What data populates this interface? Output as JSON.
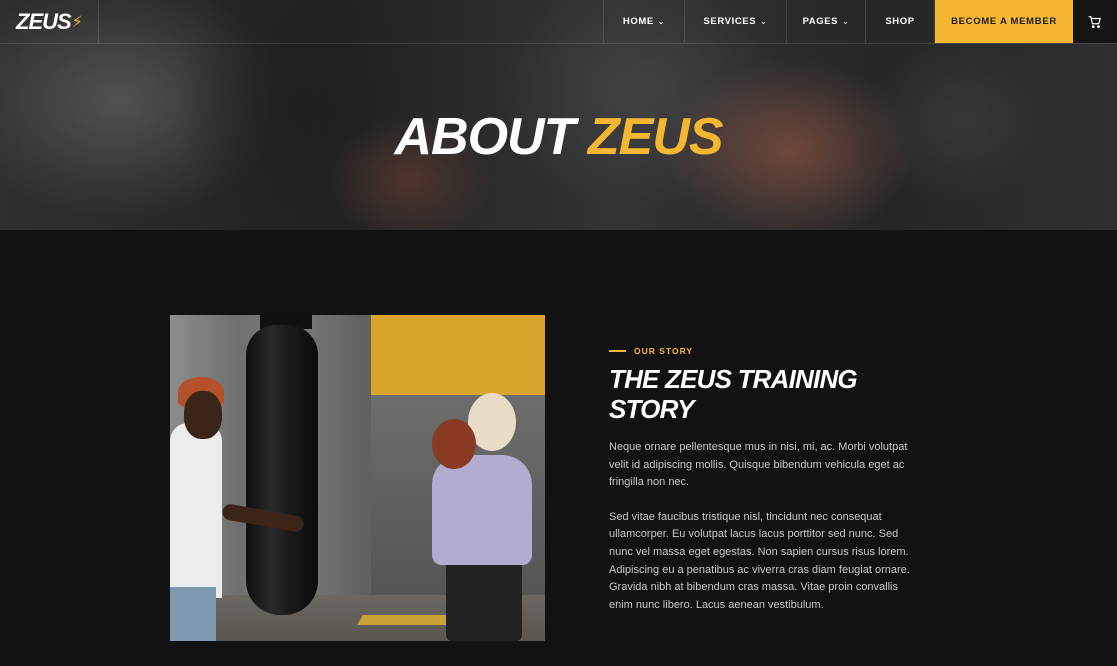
{
  "brand": {
    "logo_text": "ZEUS",
    "logo_mark": "⚡",
    "accent": "#f5b731"
  },
  "nav": {
    "items": [
      {
        "label": "HOME",
        "has_dropdown": true
      },
      {
        "label": "SERVICES",
        "has_dropdown": true
      },
      {
        "label": "PAGES",
        "has_dropdown": true
      },
      {
        "label": "SHOP",
        "has_dropdown": false
      }
    ],
    "cta_label": "BECOME A MEMBER",
    "cart_icon": "cart-icon"
  },
  "hero": {
    "title_white": "ABOUT",
    "title_accent": "ZEUS"
  },
  "story": {
    "eyebrow": "OUR STORY",
    "title": "THE ZEUS TRAINING STORY",
    "paragraph_1": "Neque ornare pellentesque mus in nisi, mi, ac. Morbi volutpat velit id adipiscing mollis. Quisque bibendum vehicula eget ac fringilla non nec.",
    "paragraph_2": "Sed vitae faucibus tristique nisl, tincidunt nec consequat ullamcorper. Eu volutpat lacus lacus porttitor sed nunc. Sed nunc vel massa eget egestas. Non sapien cursus risus lorem. Adipiscing eu a penatibus ac viverra cras diam feugiat ornare. Gravida nibh at bibendum cras massa. Vitae proin convallis enim nunc libero. Lacus aenean vestibulum."
  }
}
